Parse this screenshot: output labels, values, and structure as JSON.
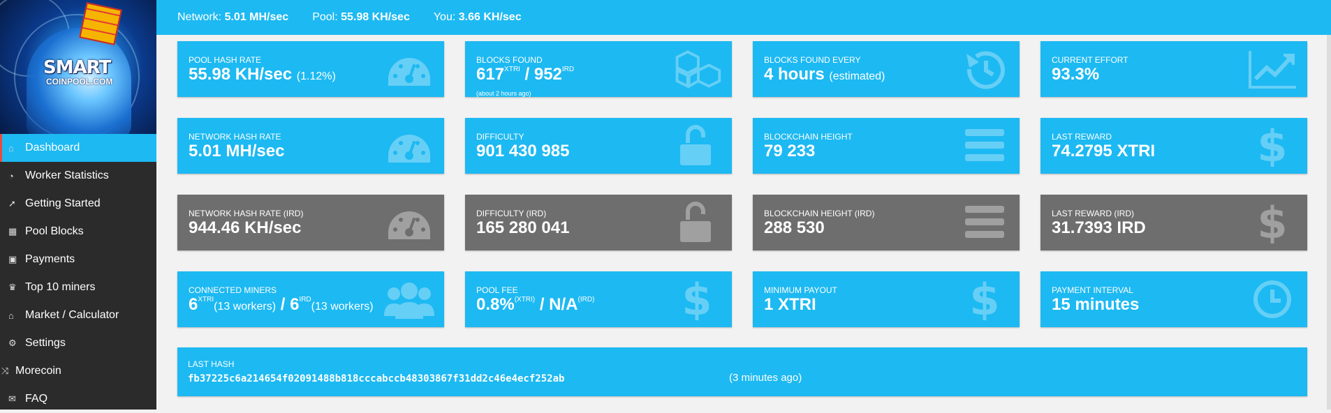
{
  "brand": {
    "line1": "SMART",
    "line2": "COINPOOL.COM"
  },
  "sidebar": {
    "items": [
      {
        "label": "Dashboard",
        "icon": "home-icon",
        "glyph": "⌂"
      },
      {
        "label": "Worker Statistics",
        "icon": "gauge-icon",
        "glyph": "◔"
      },
      {
        "label": "Getting Started",
        "icon": "rocket-icon",
        "glyph": "➚"
      },
      {
        "label": "Pool Blocks",
        "icon": "cubes-icon",
        "glyph": "▦"
      },
      {
        "label": "Payments",
        "icon": "money-icon",
        "glyph": "▣"
      },
      {
        "label": "Top 10 miners",
        "icon": "trophy-icon",
        "glyph": "♛"
      },
      {
        "label": "Market / Calculator",
        "icon": "bank-icon",
        "glyph": "⌂"
      },
      {
        "label": "Settings",
        "icon": "gears-icon",
        "glyph": "⚙"
      },
      {
        "label": "Morecoin",
        "icon": "shuffle-icon",
        "glyph": "⤨"
      },
      {
        "label": "FAQ",
        "icon": "comments-icon",
        "glyph": "✉"
      }
    ]
  },
  "topbar": {
    "network_label": "Network:",
    "network_value": "5.01 MH/sec",
    "pool_label": "Pool:",
    "pool_value": "55.98 KH/sec",
    "you_label": "You:",
    "you_value": "3.66 KH/sec"
  },
  "cards": {
    "pool_hash": {
      "label": "POOL HASH RATE",
      "value": "55.98 KH/sec",
      "extra": "(1.12%)",
      "icon": "dashboard-icon"
    },
    "blocks_found": {
      "label": "BLOCKS FOUND",
      "v1": "617",
      "s1": "XTRI",
      "sep": " / ",
      "v2": "952",
      "s2": "IRD",
      "note": "(about 2 hours ago)",
      "icon": "cubes-icon"
    },
    "blocks_every": {
      "label": "BLOCKS FOUND EVERY",
      "value": "4 hours",
      "extra": "(estimated)",
      "icon": "history-icon"
    },
    "effort": {
      "label": "CURRENT EFFORT",
      "value": "93.3%",
      "icon": "line-chart-icon"
    },
    "net_hash": {
      "label": "NETWORK HASH RATE",
      "value": "5.01 MH/sec",
      "icon": "dashboard-icon"
    },
    "difficulty": {
      "label": "DIFFICULTY",
      "value": "901 430 985",
      "icon": "unlock-icon"
    },
    "height": {
      "label": "BLOCKCHAIN HEIGHT",
      "value": "79 233",
      "icon": "bars-icon"
    },
    "reward": {
      "label": "LAST REWARD",
      "value": "74.2795 XTRI",
      "icon": "dollar-icon"
    },
    "net_hash_ird": {
      "label": "NETWORK HASH RATE (IRD)",
      "value": "944.46 KH/sec",
      "icon": "dashboard-icon"
    },
    "difficulty_ird": {
      "label": "DIFFICULTY (IRD)",
      "value": "165 280 041",
      "icon": "unlock-icon"
    },
    "height_ird": {
      "label": "BLOCKCHAIN HEIGHT (IRD)",
      "value": "288 530",
      "icon": "bars-icon"
    },
    "reward_ird": {
      "label": "LAST REWARD (IRD)",
      "value": "31.7393 IRD",
      "icon": "dollar-icon"
    },
    "miners": {
      "label": "CONNECTED MINERS",
      "v1": "6",
      "s1": "XTRI",
      "w1": "(13 workers)",
      "sep": " / ",
      "v2": "6",
      "s2": "IRD",
      "w2": "(13 workers)",
      "icon": "users-icon"
    },
    "fee": {
      "label": "POOL FEE",
      "v1": "0.8%",
      "s1": "(XTRI)",
      "sep": " / ",
      "v2": "N/A",
      "s2": "(IRD)",
      "icon": "dollar-icon"
    },
    "min_payout": {
      "label": "MINIMUM PAYOUT",
      "value": "1 XTRI",
      "icon": "dollar-icon"
    },
    "interval": {
      "label": "PAYMENT INTERVAL",
      "value": "15 minutes",
      "icon": "clock-icon"
    }
  },
  "last_hash": {
    "label": "LAST HASH",
    "hash": "fb37225c6a214654f02091488b818cccabccb48303867f31dd2c46e4ecf252ab",
    "ago": "(3 minutes ago)"
  },
  "colors": {
    "accent": "#1db9f2",
    "dark_card": "#6e6e6e",
    "sidebar": "#2b2b2b",
    "active_marker": "#e74c3c"
  }
}
